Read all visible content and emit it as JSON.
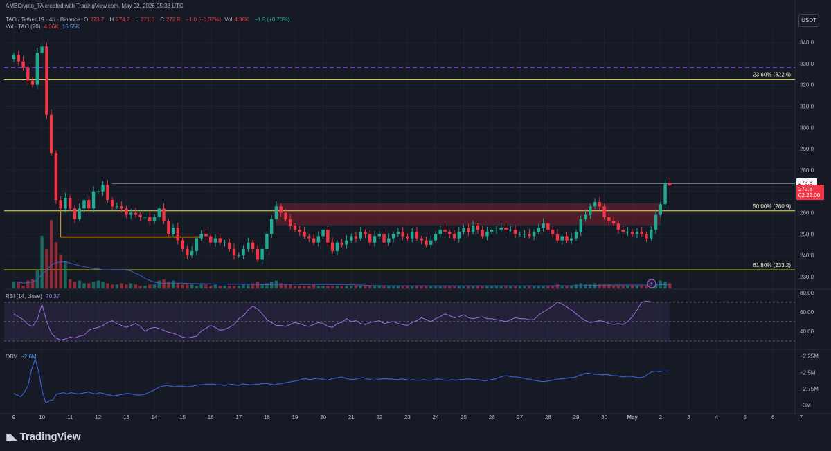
{
  "header": {
    "publisher": "AMBCrypto_TA created with TradingView.com, May 02, 2026 05:38 UTC",
    "symbol": "TAO / TetherUS · 4h · Binance",
    "ohlc": {
      "o_label": "O",
      "o": "273.7",
      "h_label": "H",
      "h": "274.2",
      "l_label": "L",
      "l": "271.0",
      "c_label": "C",
      "c": "272.8",
      "change": "−1.0 (−0.37%)",
      "vol_label": "Vol",
      "vol": "4.36K",
      "vol_change": "+1.9 (+0.70%)"
    },
    "volume_indicator": {
      "label": "Vol · TAO (20)",
      "value": "4.36K",
      "ma": "16.55K"
    },
    "currency_button": "USDT"
  },
  "colors": {
    "background": "#161a25",
    "grid": "#1f2330",
    "up": "#22ab94",
    "down": "#f23645",
    "fib": "#e8e843",
    "dashed_level": "#7b4fd6",
    "support": "#f5a623",
    "resistance": "#c8cbd3",
    "zone": "#7a1f2b",
    "rsi": "#9c6fde",
    "obv": "#3a5fcf",
    "volume_ma": "#3a5fcf"
  },
  "chart_data": {
    "type": "candlestick",
    "timeframe": "4h",
    "price_axis": {
      "ticks": [
        "340.0",
        "330.0",
        "320.0",
        "310.0",
        "300.0",
        "290.0",
        "280.0",
        "270.0",
        "260.0",
        "250.0",
        "240.0",
        "230.0"
      ],
      "range": [
        226,
        346
      ]
    },
    "time_axis": {
      "labels": [
        "9",
        "10",
        "11",
        "12",
        "13",
        "14",
        "15",
        "16",
        "17",
        "18",
        "19",
        "20",
        "21",
        "22",
        "23",
        "24",
        "25",
        "26",
        "27",
        "28",
        "29",
        "30",
        "May",
        "2",
        "3",
        "4",
        "5",
        "6",
        "7"
      ],
      "bars_per_day": 6,
      "last_bar_index": 140
    },
    "price_labels": {
      "last": "273.8",
      "current": "272.8",
      "countdown": "02:22:00"
    },
    "fib_levels": [
      {
        "label": "23.60% (322.6)",
        "price": 322.6
      },
      {
        "label": "50.00% (260.9)",
        "price": 260.9
      },
      {
        "label": "61.80% (233.2)",
        "price": 233.2
      }
    ],
    "dashed_level": 328.0,
    "resistance": {
      "price": 273.8,
      "from_bar": 21
    },
    "support": {
      "price": 248.6,
      "from_bar": 10,
      "to_bar": 40
    },
    "zone": {
      "high": 264.3,
      "low": 254.3,
      "from_bar": 56,
      "to_bar": 138
    },
    "closes": [
      334,
      331,
      328,
      322,
      320,
      335,
      338,
      306,
      288,
      266,
      262,
      267,
      262,
      257,
      262,
      266,
      262,
      270,
      270,
      273,
      266,
      263,
      263,
      262,
      259,
      260,
      259,
      258,
      258,
      256,
      258,
      262,
      256,
      250,
      253,
      247,
      243,
      240,
      242,
      248,
      250,
      249,
      246,
      248,
      246,
      246,
      243,
      240,
      240,
      243,
      246,
      243,
      238,
      243,
      250,
      257,
      263,
      260,
      257,
      254,
      252,
      251,
      249,
      248,
      246,
      249,
      252,
      246,
      242,
      246,
      245,
      247,
      249,
      248,
      251,
      250,
      246,
      249,
      250,
      246,
      248,
      250,
      251,
      249,
      248,
      251,
      248,
      247,
      245,
      247,
      250,
      252,
      251,
      250,
      248,
      251,
      253,
      251,
      254,
      252,
      249,
      251,
      252,
      252,
      253,
      252,
      252,
      250,
      250,
      250,
      249,
      251,
      253,
      255,
      252,
      250,
      247,
      249,
      247,
      248,
      251,
      257,
      259,
      263,
      265,
      263,
      258,
      256,
      255,
      252,
      251,
      251,
      250,
      251,
      250,
      248,
      252,
      259,
      264,
      274,
      272.8
    ],
    "volume": {
      "values": [
        5,
        5,
        2,
        6,
        7,
        14,
        40,
        30,
        52,
        35,
        26,
        21,
        7,
        5,
        6,
        4,
        4,
        5,
        6,
        5,
        4,
        3,
        3,
        4,
        3,
        4,
        3,
        2,
        2,
        3,
        3,
        6,
        7,
        5,
        6,
        4,
        3,
        3,
        3,
        2,
        3,
        3,
        2,
        3,
        2,
        2,
        2,
        2,
        2,
        3,
        3,
        4,
        5,
        3,
        4,
        5,
        6,
        4,
        3,
        3,
        2,
        2,
        2,
        2,
        3,
        2,
        2,
        2,
        2,
        2,
        2,
        2,
        2,
        2,
        2,
        2,
        2,
        2,
        2,
        2,
        2,
        2,
        2,
        2,
        2,
        2,
        2,
        2,
        2,
        2,
        2,
        2,
        2,
        2,
        2,
        2,
        2,
        2,
        2,
        2,
        2,
        2,
        2,
        2,
        2,
        2,
        2,
        2,
        2,
        2,
        2,
        2,
        2,
        2,
        2,
        2,
        3,
        2,
        2,
        2,
        3,
        4,
        3,
        3,
        4,
        3,
        3,
        3,
        2,
        2,
        2,
        2,
        2,
        2,
        2,
        2,
        2,
        4,
        6,
        5,
        4
      ],
      "unit": "K"
    },
    "rsi": {
      "label": "RSI (14, close)",
      "value": "70.37",
      "ticks": [
        "80.00",
        "60.00",
        "40.00"
      ],
      "band": [
        30,
        70
      ],
      "range": [
        25,
        82
      ],
      "values": [
        58,
        55,
        52,
        47,
        45,
        52,
        68,
        50,
        38,
        33,
        31,
        32,
        34,
        33,
        35,
        36,
        41,
        43,
        44,
        46,
        49,
        51,
        48,
        46,
        44,
        46,
        48,
        45,
        40,
        43,
        44,
        43,
        41,
        39,
        38,
        36,
        34,
        33,
        34,
        35,
        40,
        43,
        46,
        44,
        41,
        42,
        44,
        47,
        53,
        56,
        62,
        66,
        63,
        58,
        52,
        49,
        46,
        46,
        45,
        47,
        49,
        48,
        46,
        45,
        47,
        49,
        48,
        45,
        44,
        48,
        49,
        53,
        50,
        51,
        48,
        47,
        49,
        50,
        51,
        48,
        49,
        50,
        48,
        47,
        46,
        49,
        51,
        54,
        52,
        50,
        53,
        55,
        58,
        56,
        54,
        55,
        57,
        54,
        53,
        54,
        55,
        53,
        53,
        52,
        51,
        50,
        52,
        54,
        53,
        53,
        52,
        52,
        57,
        60,
        63,
        66,
        70,
        68,
        65,
        62,
        58,
        54,
        51,
        49,
        50,
        51,
        50,
        48,
        47,
        48,
        47,
        50,
        55,
        62,
        70,
        71,
        70.37
      ]
    },
    "obv": {
      "label": "OBV",
      "value": "−2.6M",
      "ticks": [
        "−2.25M",
        "−2.5M",
        "−2.75M",
        "−3M"
      ],
      "range": [
        -3.1,
        -2.2
      ],
      "values": [
        -2.82,
        -2.85,
        -2.87,
        -2.8,
        -2.7,
        -2.45,
        -2.29,
        -2.5,
        -2.8,
        -2.97,
        -2.93,
        -2.92,
        -2.83,
        -2.82,
        -2.81,
        -2.83,
        -2.81,
        -2.82,
        -2.83,
        -2.82,
        -2.81,
        -2.8,
        -2.82,
        -2.83,
        -2.81,
        -2.82,
        -2.84,
        -2.85,
        -2.86,
        -2.85,
        -2.84,
        -2.83,
        -2.82,
        -2.83,
        -2.84,
        -2.85,
        -2.84,
        -2.83,
        -2.8,
        -2.78,
        -2.75,
        -2.72,
        -2.71,
        -2.7,
        -2.71,
        -2.72,
        -2.71,
        -2.71,
        -2.72,
        -2.72,
        -2.71,
        -2.7,
        -2.69,
        -2.69,
        -2.68,
        -2.68,
        -2.68,
        -2.69,
        -2.69,
        -2.7,
        -2.69,
        -2.68,
        -2.69,
        -2.7,
        -2.68,
        -2.68,
        -2.69,
        -2.69,
        -2.68,
        -2.68,
        -2.67,
        -2.67,
        -2.68,
        -2.69,
        -2.68,
        -2.67,
        -2.66,
        -2.65,
        -2.64,
        -2.63,
        -2.62,
        -2.6,
        -2.6,
        -2.61,
        -2.6,
        -2.59,
        -2.6,
        -2.61,
        -2.62,
        -2.6,
        -2.59,
        -2.58,
        -2.57,
        -2.59,
        -2.6,
        -2.61,
        -2.6,
        -2.59,
        -2.58,
        -2.6,
        -2.61,
        -2.62,
        -2.61,
        -2.6,
        -2.6,
        -2.6,
        -2.6,
        -2.61,
        -2.61,
        -2.6,
        -2.61,
        -2.62,
        -2.61,
        -2.62,
        -2.62,
        -2.61,
        -2.62,
        -2.62,
        -2.61,
        -2.6,
        -2.61,
        -2.62,
        -2.62,
        -2.61,
        -2.62,
        -2.61,
        -2.61,
        -2.6,
        -2.6,
        -2.61,
        -2.61,
        -2.62,
        -2.63,
        -2.62,
        -2.61,
        -2.6,
        -2.58,
        -2.56,
        -2.55,
        -2.56,
        -2.57,
        -2.57,
        -2.58,
        -2.59,
        -2.6,
        -2.61,
        -2.62,
        -2.63,
        -2.64,
        -2.64,
        -2.63,
        -2.62,
        -2.61,
        -2.6,
        -2.6,
        -2.59,
        -2.58,
        -2.58,
        -2.56,
        -2.54,
        -2.52,
        -2.51,
        -2.52,
        -2.53,
        -2.53,
        -2.54,
        -2.53,
        -2.54,
        -2.55,
        -2.55,
        -2.56,
        -2.57,
        -2.56,
        -2.56,
        -2.57,
        -2.58,
        -2.58,
        -2.56,
        -2.52,
        -2.49,
        -2.48,
        -2.49,
        -2.48,
        -2.48,
        -2.48
      ]
    }
  },
  "branding": {
    "logo_text": "TradingView",
    "logo_mark": "TV"
  }
}
